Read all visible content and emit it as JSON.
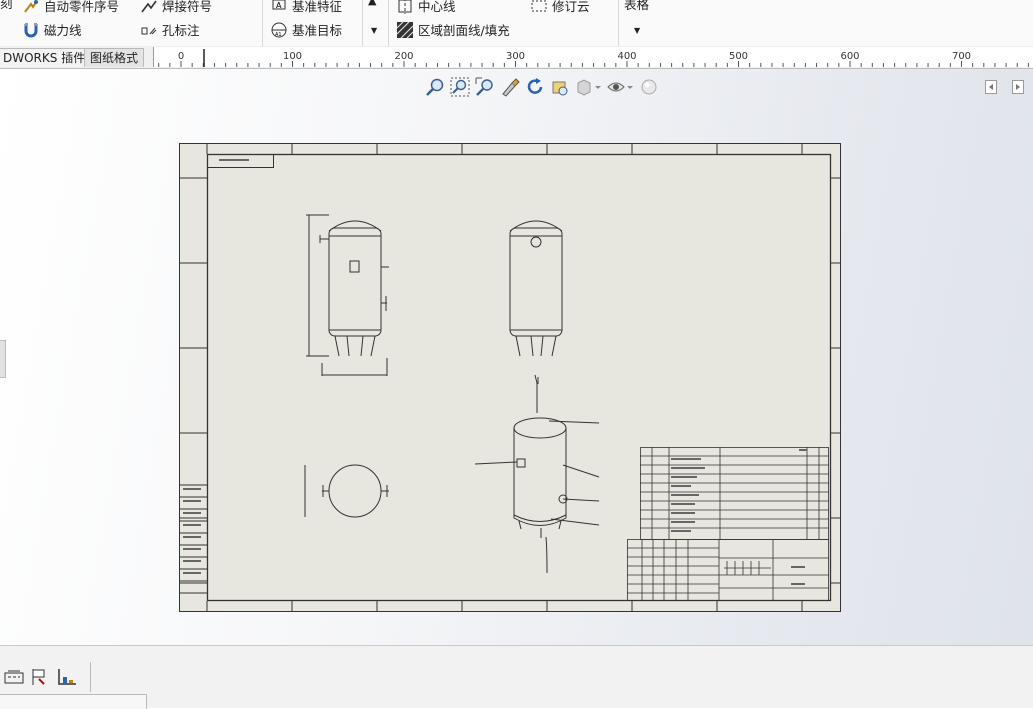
{
  "ribbon": {
    "col1": {
      "partial_top": "刻"
    },
    "col2": {
      "item1": "自动零件序号",
      "item2": "磁力线"
    },
    "col3": {
      "item1": "焊接符号",
      "item2": "孔标注"
    },
    "col4": {
      "item1": "基准特征",
      "item2": "基准目标"
    },
    "col5": {
      "item1": "中心线",
      "item2": "区域剖面线/填充"
    },
    "col6": {
      "item1": "修订云"
    },
    "col7": {
      "item1": "表格"
    }
  },
  "tabs": [
    {
      "label": "DWORKS 插件"
    },
    {
      "label": "图纸格式"
    }
  ],
  "ruler": {
    "labels": [
      "0",
      "100",
      "200",
      "300",
      "400",
      "500",
      "600",
      "700"
    ]
  },
  "view_toolbar": {
    "icons": [
      "zoom-to-fit-icon",
      "zoom-to-area-icon",
      "zoom-in-out-icon",
      "select-icon",
      "rotate-icon",
      "view-orientation-icon",
      "display-style-icon",
      "hide-show-icon",
      "appearance-icon"
    ]
  },
  "colors": {
    "sheet": "#e7e6df",
    "line": "#333333",
    "ribbon_bg": "#fafafa"
  }
}
